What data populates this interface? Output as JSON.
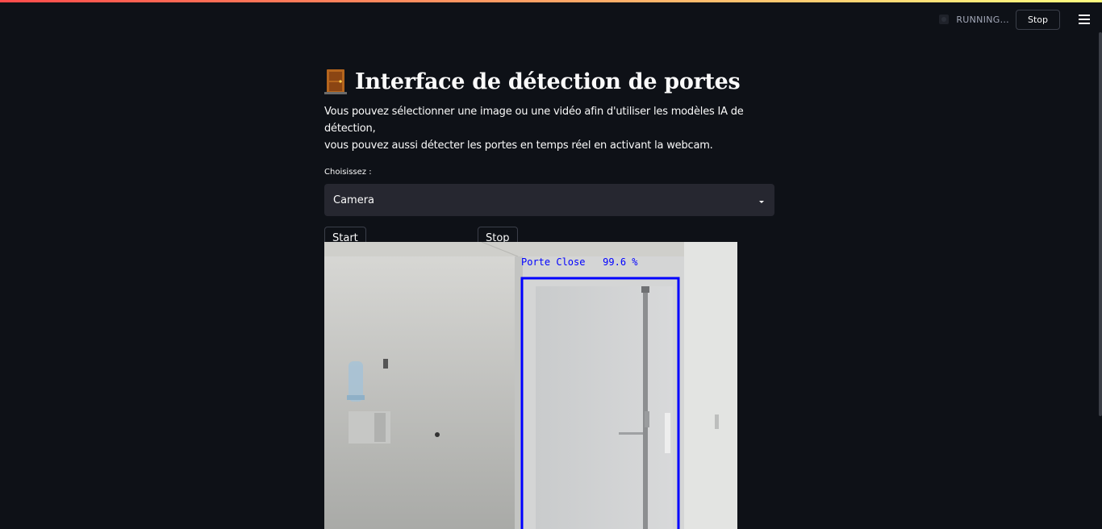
{
  "header": {
    "status": "RUNNING...",
    "stop_label": "Stop"
  },
  "main": {
    "title": "Interface de détection de portes",
    "description_line1": "Vous pouvez sélectionner une image ou une vidéo afin d'utiliser les modèles IA de détection,",
    "description_line2": "vous pouvez aussi détecter les portes en temps réel en activant la webcam.",
    "select_label": "Choisissez :",
    "select_value": "Camera",
    "start_label": "Start",
    "stop_label": "Stop"
  },
  "video": {
    "detection_label": "Porte Close   99.6 %"
  },
  "colors": {
    "background": "#0e1117",
    "select_bg": "#262730",
    "detection_box": "#0000ff"
  },
  "icons": [
    "door-icon",
    "running-icon",
    "chevron-down-icon",
    "hamburger-menu-icon"
  ]
}
